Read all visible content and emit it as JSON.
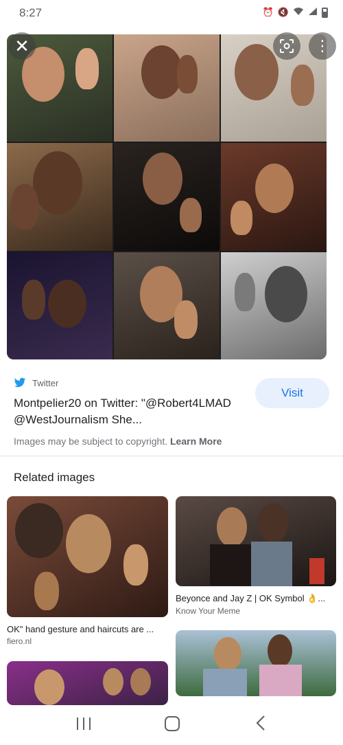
{
  "status_bar": {
    "time": "8:27",
    "icons": [
      "alarm-icon",
      "mute-icon",
      "wifi-icon",
      "signal-icon",
      "battery-icon"
    ]
  },
  "viewer": {
    "close_icon": "close-icon",
    "lens_icon": "lens-icon",
    "more_icon": "more-vert-icon"
  },
  "result": {
    "source": "Twitter",
    "source_icon": "twitter-icon",
    "title": "Montpelier20 on Twitter: \"@Robert4LMAD @WestJournalism She...",
    "visit_label": "Visit",
    "copyright_text": "Images may be subject to copyright.",
    "learn_more_label": "Learn More"
  },
  "related": {
    "heading": "Related images",
    "items": [
      {
        "caption": "OK\" hand gesture and haircuts are ...",
        "site": "fiero.nl"
      },
      {
        "caption": "Beyonce and Jay Z | OK Symbol 👌...",
        "site": "Know Your Meme"
      },
      {
        "caption": "",
        "site": ""
      },
      {
        "caption": "",
        "site": ""
      }
    ]
  },
  "navigation": {
    "recent_icon": "recent-apps-icon",
    "home_icon": "home-icon",
    "back_icon": "back-icon"
  },
  "colors": {
    "accent": "#1a73e8",
    "visit_bg": "#e8f0fe",
    "twitter": "#1d9bf0"
  }
}
